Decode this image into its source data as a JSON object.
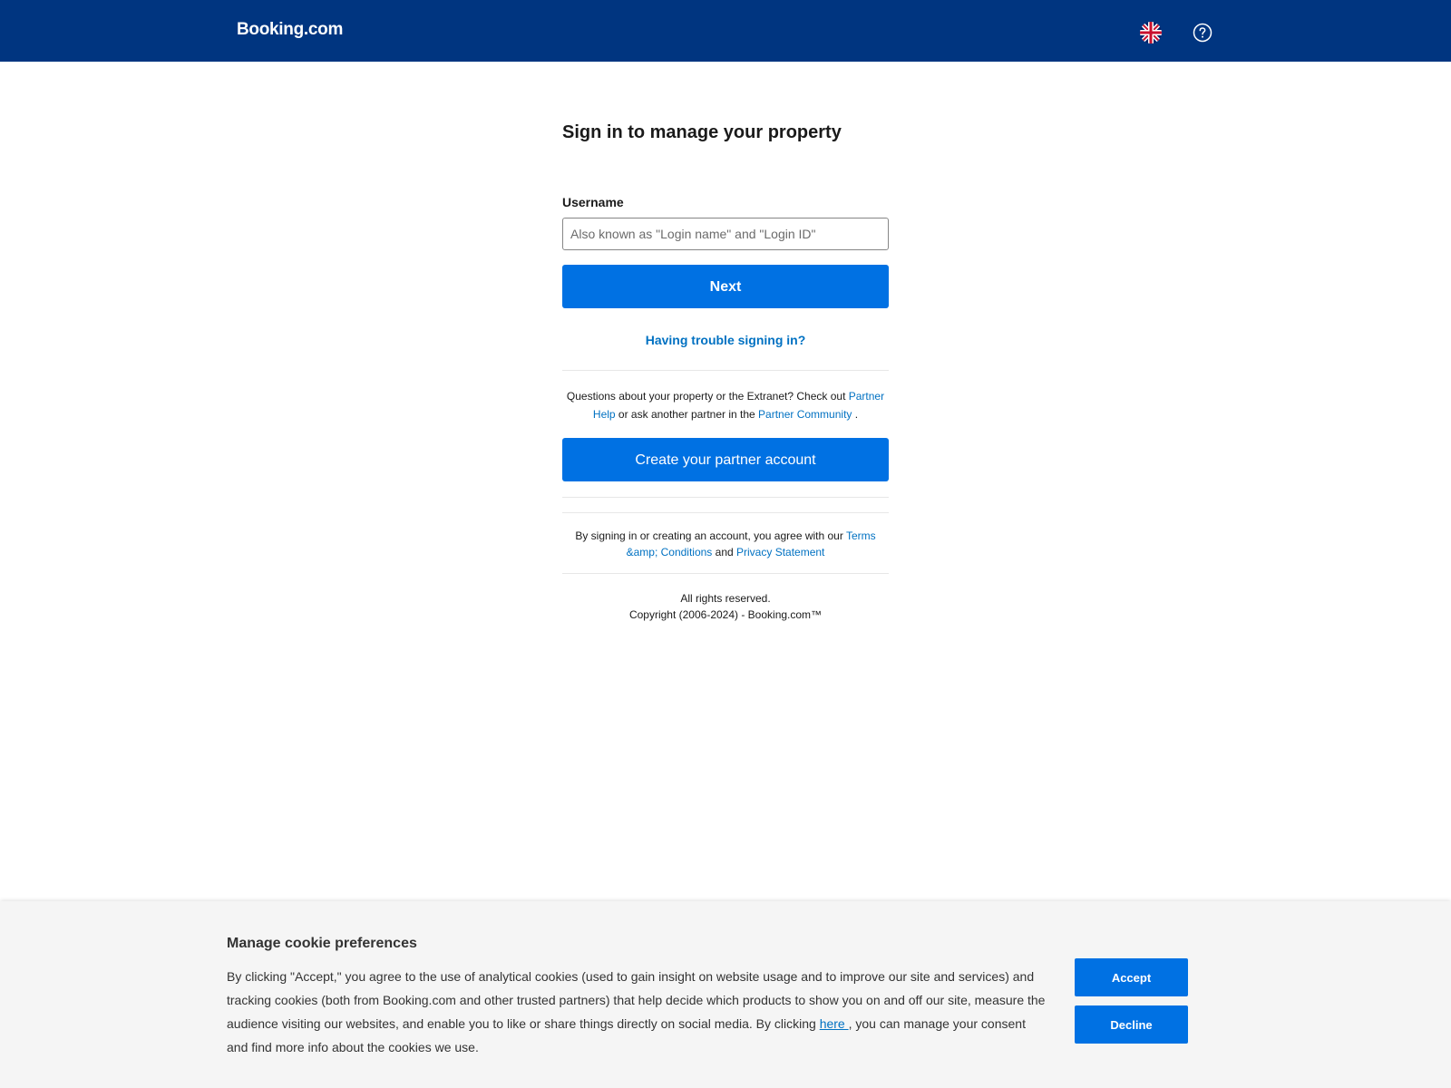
{
  "header": {
    "logo": "Booking.com",
    "language_icon": "uk-flag-icon",
    "help_icon": "question-circle-icon"
  },
  "signin": {
    "title": "Sign in to manage your property",
    "username_label": "Username",
    "username_placeholder": "Also known as \"Login name\" and \"Login ID\"",
    "username_value": "",
    "next_button": "Next",
    "trouble_link": "Having trouble signing in?"
  },
  "help": {
    "text_before": "Questions about your property or the Extranet? Check out ",
    "partner_help_link": "Partner Help",
    "text_middle": " or ask another partner in the ",
    "partner_community_link": "Partner Community",
    "text_after": " ."
  },
  "create_button": "Create your partner account",
  "terms": {
    "text_before": "By signing in or creating an account, you agree with our ",
    "terms_link": "Terms &amp; Conditions",
    "text_middle": " and ",
    "privacy_link": "Privacy Statement"
  },
  "footer": {
    "rights": "All rights reserved.",
    "copyright": "Copyright (2006-2024) - Booking.com™"
  },
  "cookie": {
    "title": "Manage cookie preferences",
    "body_before": "By clicking \"Accept,\" you agree to the use of analytical cookies (used to gain insight on website usage and to improve our site and services) and tracking cookies (both from Booking.com and other trusted partners) that help decide which products to show you on and off our site, measure the audience visiting our websites, and enable you to like or share things directly on social media. By clicking ",
    "here_link": "here ",
    "body_after": ", you can manage your consent and find more info about the cookies we use.",
    "accept": "Accept",
    "decline": "Decline"
  },
  "colors": {
    "header_bg": "#003580",
    "primary_button": "#0071e3",
    "link": "#0071c2",
    "cookie_bg": "#f5f5f5"
  }
}
